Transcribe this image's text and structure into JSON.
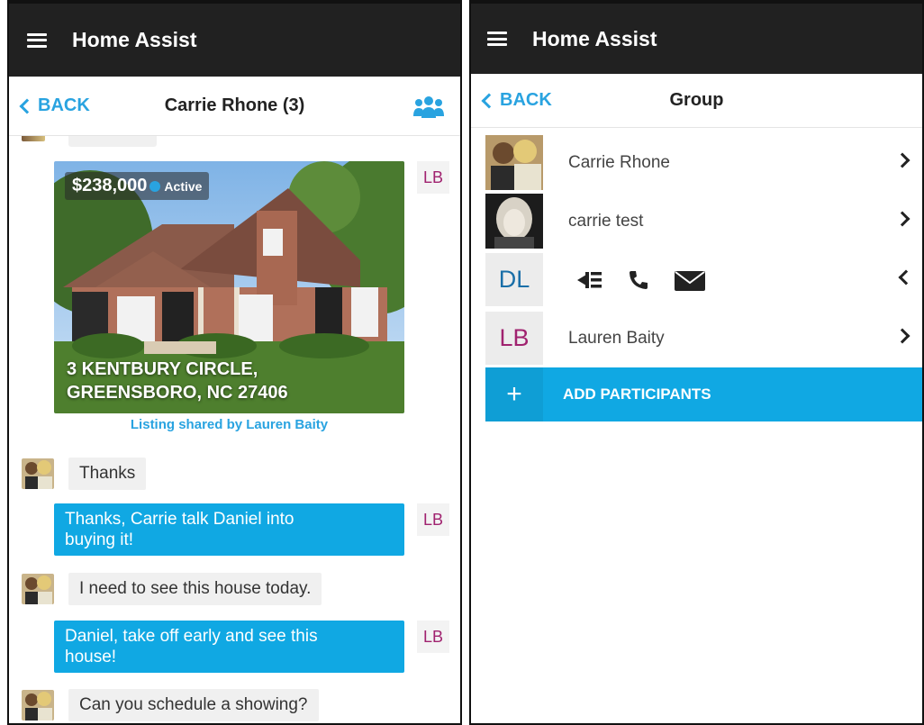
{
  "app": {
    "title": "Home Assist",
    "menu_icon": "hamburger-menu-icon"
  },
  "chat_screen": {
    "back_label": "BACK",
    "title": "Carrie Rhone (3)",
    "group_icon": "group-icon",
    "listing": {
      "price": "$238,000",
      "status": "Active",
      "address_line1": "3 KENTBURY CIRCLE,",
      "address_line2": "GREENSBORO, NC 27406",
      "shared_by": "Listing shared by Lauren Baity"
    },
    "sender_initials": "LB",
    "messages": [
      {
        "direction": "in",
        "text": "Thanks"
      },
      {
        "direction": "out",
        "line1": "Thanks, Carrie talk Daniel into",
        "line2": "buying it!"
      },
      {
        "direction": "in",
        "text": "I need to see this house today."
      },
      {
        "direction": "out",
        "line1": "Daniel, take off early and see this",
        "line2": "house!"
      },
      {
        "direction": "in",
        "text": "Can you schedule a showing?"
      }
    ]
  },
  "group_screen": {
    "back_label": "BACK",
    "title": "Group",
    "participants": [
      {
        "name": "Carrie Rhone"
      },
      {
        "name": "carrie test"
      },
      {
        "initials": "DL",
        "actions": [
          "message-icon",
          "phone-icon",
          "email-icon"
        ]
      },
      {
        "initials": "LB",
        "name": "Lauren Baity"
      }
    ],
    "add_label": "ADD PARTICIPANTS",
    "add_symbol": "+"
  },
  "colors": {
    "accent": "#10a8e3",
    "link": "#29a3e0",
    "appbar": "#212121",
    "initials_lb": "#a0226f",
    "initials_dl": "#1a6fa8"
  }
}
